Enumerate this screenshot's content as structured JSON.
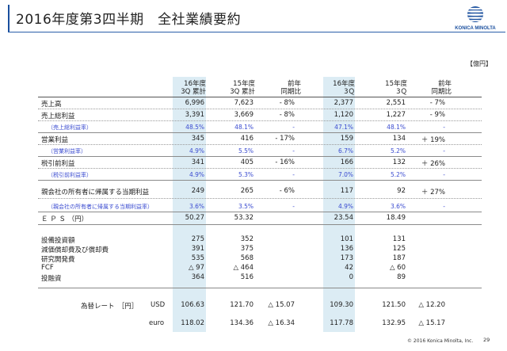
{
  "title": "2016年度第3四半期　全社業績要約",
  "logo_text": "KONICA MINOLTA",
  "unit": "【億円】",
  "headers": [
    {
      "line1": "16年度",
      "line2": "3Q 累計"
    },
    {
      "line1": "15年度",
      "line2": "3Q 累計"
    },
    {
      "line1": "前年",
      "line2": "同期比"
    },
    {
      "line1": "16年度",
      "line2": "3Ｑ"
    },
    {
      "line1": "15年度",
      "line2": "3Ｑ"
    },
    {
      "line1": "前年",
      "line2": "同期比"
    }
  ],
  "rows": [
    {
      "label": "売上高",
      "values": [
        "6,996",
        "7,623",
        "- 8%",
        "2,377",
        "2,551",
        "- 7%"
      ]
    },
    {
      "label": "売上総利益",
      "values": [
        "3,391",
        "3,669",
        "- 8%",
        "1,120",
        "1,227",
        "- 9%"
      ]
    },
    {
      "label": "（売上総利益率）",
      "values": [
        "48.5%",
        "48.1%",
        "-",
        "47.1%",
        "48.1%",
        "-"
      ]
    },
    {
      "label": "営業利益",
      "values": [
        "345",
        "416",
        "- 17%",
        "159",
        "134",
        "＋ 19%"
      ]
    },
    {
      "label": "（営業利益率）",
      "values": [
        "4.9%",
        "5.5%",
        "-",
        "6.7%",
        "5.2%",
        "-"
      ]
    },
    {
      "label": "税引前利益",
      "values": [
        "341",
        "405",
        "- 16%",
        "166",
        "132",
        "＋ 26%"
      ]
    },
    {
      "label": "（税引前利益率）",
      "values": [
        "4.9%",
        "5.3%",
        "-",
        "7.0%",
        "5.2%",
        "-"
      ]
    },
    {
      "label": "親会社の所有者に帰属する当期利益",
      "values": [
        "249",
        "265",
        "- 6%",
        "117",
        "92",
        "＋ 27%"
      ]
    },
    {
      "label": "（親会社の所有者に帰属する当期利益率）",
      "values": [
        "3.6%",
        "3.5%",
        "-",
        "4.9%",
        "3.6%",
        "-"
      ]
    },
    {
      "label": "Ｅ Ｐ Ｓ （円）",
      "values": [
        "50.27",
        "53.32",
        "",
        "23.54",
        "18.49",
        ""
      ]
    },
    {
      "label": "設備投資額",
      "values": [
        "275",
        "352",
        "",
        "101",
        "131",
        ""
      ]
    },
    {
      "label": "減価償却費及び償却費",
      "values": [
        "391",
        "375",
        "",
        "136",
        "125",
        ""
      ]
    },
    {
      "label": "研究開発費",
      "values": [
        "535",
        "568",
        "",
        "173",
        "187",
        ""
      ]
    },
    {
      "label": "FCF",
      "values": [
        "△ 97",
        "△ 464",
        "",
        "42",
        "△ 60",
        ""
      ]
    },
    {
      "label": "投融資",
      "values": [
        "364",
        "516",
        "",
        "0",
        "89",
        ""
      ]
    }
  ],
  "fx": {
    "label": "為替レート　［円］",
    "rows": [
      {
        "currency": "USD",
        "values": [
          "106.63",
          "121.70",
          "△ 15.07",
          "109.30",
          "121.50",
          "△ 12.20"
        ]
      },
      {
        "currency": "euro",
        "values": [
          "118.02",
          "134.36",
          "△ 16.34",
          "117.78",
          "132.95",
          "△ 15.17"
        ]
      }
    ]
  },
  "footer": "© 2016 Konica Minolta, Inc.",
  "page_number": "29"
}
